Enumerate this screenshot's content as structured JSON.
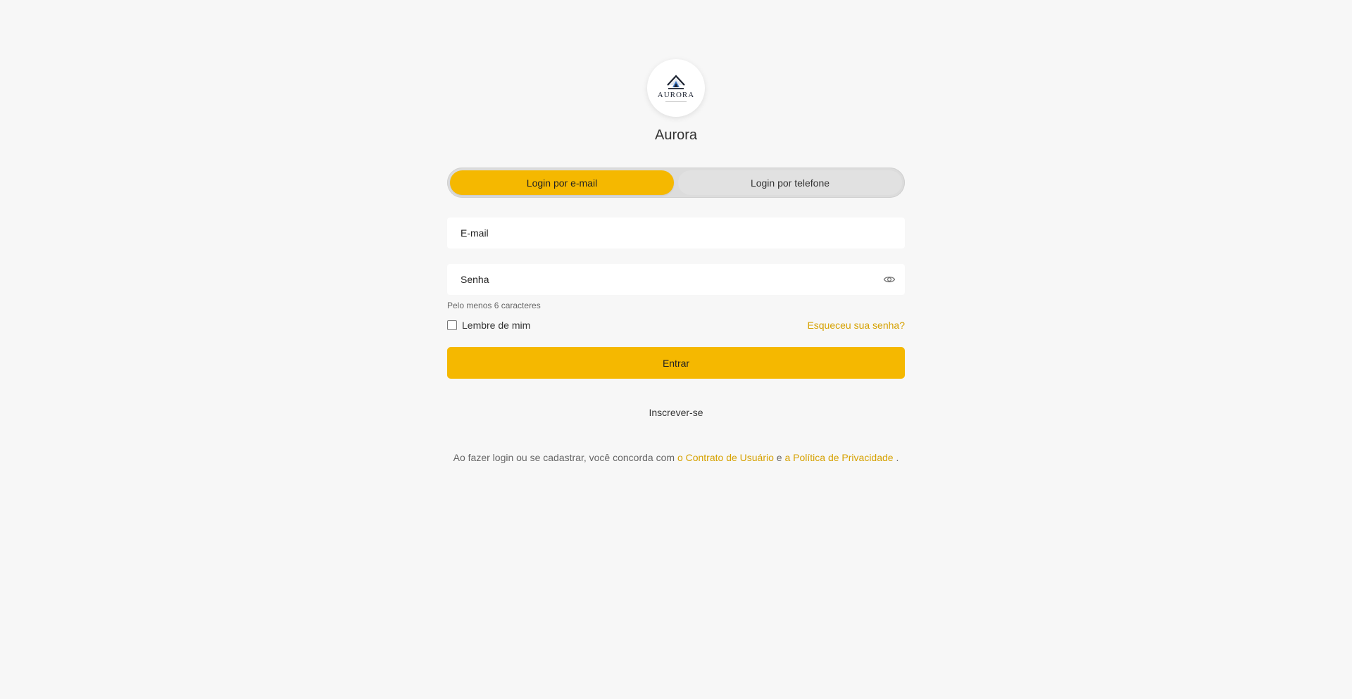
{
  "brand": {
    "logo_text": "AURORA",
    "app_name": "Aurora",
    "accent_color": "#f5b800",
    "link_color": "#d6a100"
  },
  "tabs": [
    {
      "label": "Login por e-mail",
      "active": true
    },
    {
      "label": "Login por telefone",
      "active": false
    }
  ],
  "email_field": {
    "placeholder": "E-mail",
    "value": ""
  },
  "password_field": {
    "placeholder": "Senha",
    "value": "",
    "toggle_icon": "eye-icon",
    "hint": "Pelo menos 6 caracteres"
  },
  "remember": {
    "label": "Lembre de mim",
    "checked": false
  },
  "forgot_label": "Esqueceu sua senha?",
  "submit_label": "Entrar",
  "signup_label": "Inscrever-se",
  "terms": {
    "prefix": "Ao fazer login ou se cadastrar, você concorda com",
    "user_agreement": "o Contrato de Usuário",
    "conjunction": "e",
    "privacy_policy": "a Política de Privacidade",
    "suffix": "."
  }
}
